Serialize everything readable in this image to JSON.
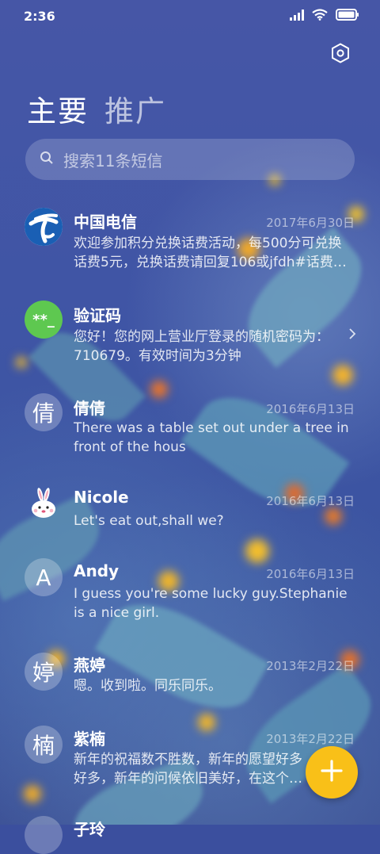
{
  "status_bar": {
    "time": "2:36"
  },
  "tabs": [
    {
      "label": "主要"
    },
    {
      "label": "推广"
    }
  ],
  "search": {
    "placeholder": "搜索11条短信"
  },
  "messages": [
    {
      "name": "中国电信",
      "date": "2017年6月30日",
      "preview": "欢迎参加积分兑换话费活动，每500分可兑换话费5元，兑换话费请回复106或jfdh#话费…",
      "avatar_icon": "china-telecom-logo-icon"
    },
    {
      "name": "验证码",
      "date": "",
      "preview": "您好！您的网上营业厅登录的随机密码为：710679。有效时间为3分钟",
      "avatar_text": "**_",
      "avatar_color": "#5ec850"
    },
    {
      "name": "倩倩",
      "date": "2016年6月13日",
      "preview": "There was a table set out under a tree in front of the hous",
      "avatar_text": "倩"
    },
    {
      "name": "Nicole",
      "date": "2016年6月13日",
      "preview": "Let's eat out,shall we?",
      "avatar_icon": "bunny-avatar-icon"
    },
    {
      "name": "Andy",
      "date": "2016年6月13日",
      "preview": "I guess you're some lucky guy.Stephanie is a nice girl.",
      "avatar_text": "A"
    },
    {
      "name": "燕婷",
      "date": "2013年2月22日",
      "preview": "嗯。收到啦。同乐同乐。",
      "avatar_text": "婷"
    },
    {
      "name": "紫楠",
      "date": "2013年2月22日",
      "preview": "新年的祝福数不胜数，新年的愿望好多好多，新年的问候依旧美好，在这个温馨的时刻",
      "avatar_text": "楠"
    },
    {
      "name": "子玲",
      "date": "",
      "preview": "",
      "avatar_text": ""
    }
  ],
  "colors": {
    "fab": "#f9c018",
    "accent_green": "#5ec850",
    "telecom_blue": "#1a5fb4"
  }
}
